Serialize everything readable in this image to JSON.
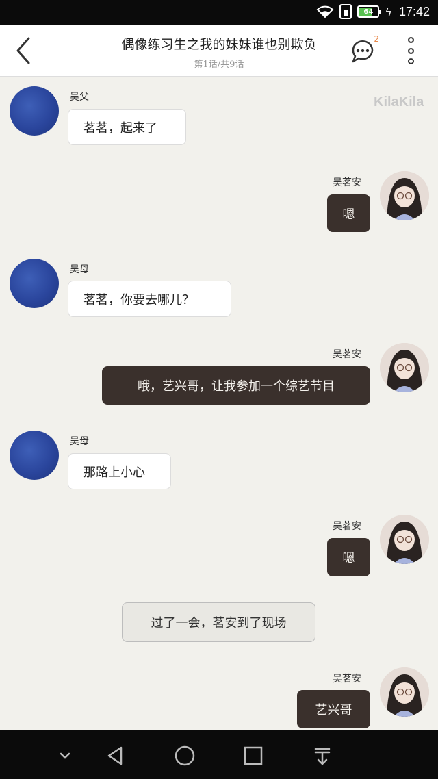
{
  "status_bar": {
    "time": "17:42",
    "battery": "64"
  },
  "header": {
    "title": "偶像练习生之我的妹妹谁也别欺负",
    "subtitle": "第1话/共9话",
    "comment_count": "2"
  },
  "watermark": "KilaKila",
  "messages": [
    {
      "name": "吴父",
      "text": "茗茗，起来了"
    },
    {
      "name": "吴茗安",
      "text": "嗯"
    },
    {
      "name": "吴母",
      "text": "茗茗，你要去哪儿？"
    },
    {
      "name": "吴茗安",
      "text": "哦，艺兴哥，让我参加一个综艺节目"
    },
    {
      "name": "吴母",
      "text": "那路上小心"
    },
    {
      "name": "吴茗安",
      "text": "嗯"
    },
    {
      "narration": "过了一会，茗安到了现场"
    },
    {
      "name": "吴茗安",
      "text": "艺兴哥"
    }
  ],
  "colors": {
    "left_bubble": "#ffffff",
    "right_bubble": "#3a302c",
    "background": "#f2f1ec"
  },
  "icons": [
    "back-icon",
    "comment-icon",
    "more-icon",
    "nav-collapse-icon",
    "nav-back-icon",
    "nav-home-icon",
    "nav-recent-icon",
    "nav-download-icon"
  ]
}
